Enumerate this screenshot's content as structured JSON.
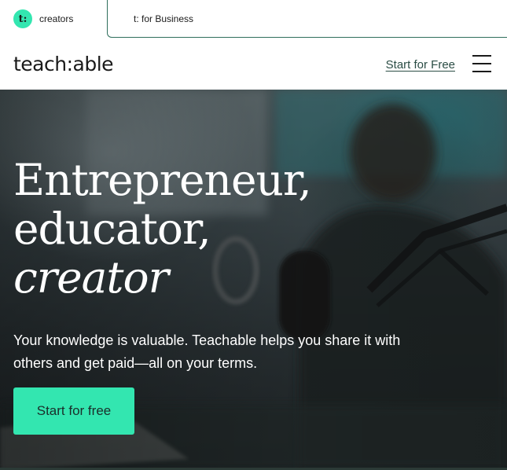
{
  "audience_tabs": {
    "creators": {
      "badge": "t:",
      "label": "creators"
    },
    "business": {
      "label": "t: for Business"
    }
  },
  "header": {
    "brand": "teach:able",
    "cta_label": "Start for Free",
    "menu_icon": "hamburger-menu-icon"
  },
  "hero": {
    "title_line1": "Entrepreneur,",
    "title_line2": "educator,",
    "title_line3": "creator",
    "subtitle": "Your knowledge is valuable. Teachable helps you share it with others and get paid—all on your terms.",
    "cta_label": "Start for free"
  },
  "colors": {
    "accent": "#33e6b0",
    "tab_border": "#2f6f5c",
    "link": "#2b4d45",
    "hero_dark": "#2b3336"
  }
}
